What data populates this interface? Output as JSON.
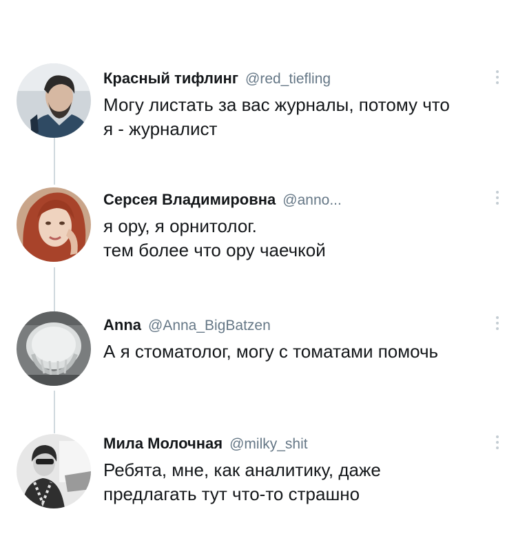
{
  "thread": {
    "tweets": [
      {
        "name": "Красный тифлинг",
        "handle": "@red_tiefling",
        "text": "Могу листать за вас журналы, потому что\nя - журналист",
        "avatar_icon": "man-with-beard-avatar",
        "avatar_colors": [
          "#3a3f45",
          "#a8b0b6",
          "#e7ddd2"
        ]
      },
      {
        "name": "Серсея Владимировна",
        "handle": "@anno...",
        "text": "я ору, я орнитолог.\nтем более что ору чаечкой",
        "avatar_icon": "red-haired-woman-avatar",
        "avatar_colors": [
          "#a8432a",
          "#d9a98b",
          "#efd9c7"
        ]
      },
      {
        "name": "Anna",
        "handle": "@Anna_BigBatzen",
        "text": "А я стоматолог, могу с томатами помочь",
        "avatar_icon": "skull-xray-avatar",
        "avatar_colors": [
          "#6c6f70",
          "#cfd3d3",
          "#262829"
        ]
      },
      {
        "name": "Мила Молочная",
        "handle": "@milky_shit",
        "text": "Ребята, мне, как аналитику, даже\nпредлагать тут что-то страшно",
        "avatar_icon": "woman-in-car-bw-avatar",
        "avatar_colors": [
          "#2b2b2b",
          "#bdbdbd",
          "#eeeeee"
        ]
      }
    ]
  }
}
